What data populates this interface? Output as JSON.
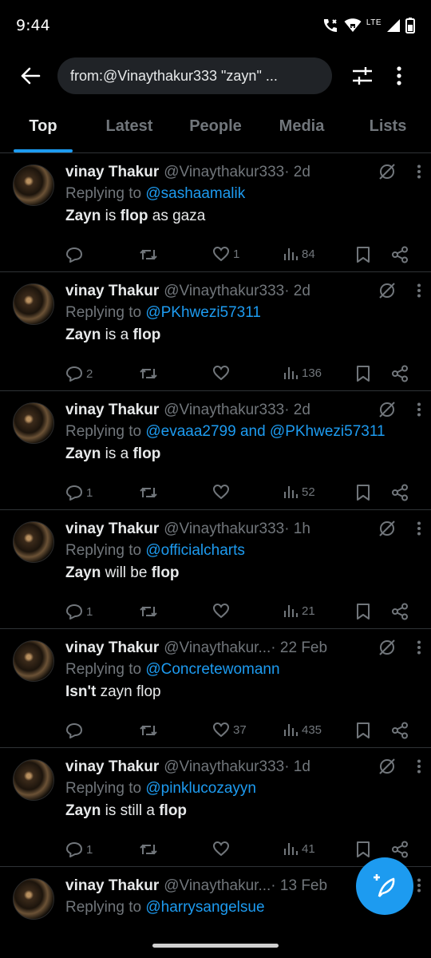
{
  "status_bar": {
    "time": "9:44",
    "network": "LTE"
  },
  "search": {
    "query": "from:@Vinaythakur333 \"zayn\" ..."
  },
  "tabs": [
    {
      "label": "Top",
      "active": true
    },
    {
      "label": "Latest",
      "active": false
    },
    {
      "label": "People",
      "active": false
    },
    {
      "label": "Media",
      "active": false
    },
    {
      "label": "Lists",
      "active": false
    }
  ],
  "tweets": [
    {
      "name": "vinay Thakur",
      "handle": "@Vinaythakur333",
      "date": " · 2d",
      "replying_prefix": "Replying to ",
      "replying_to": "@sashaamalik",
      "text_parts": [
        "Zayn",
        " is ",
        "flop",
        " as gaza",
        ""
      ],
      "replies": "",
      "likes": "1",
      "views": "84"
    },
    {
      "name": "vinay Thakur",
      "handle": "@Vinaythakur333",
      "date": " · 2d",
      "replying_prefix": "Replying to ",
      "replying_to": "@PKhwezi57311",
      "text_parts": [
        "Zayn",
        " is a ",
        "flop",
        "",
        ""
      ],
      "replies": "2",
      "likes": "",
      "views": "136"
    },
    {
      "name": "vinay Thakur",
      "handle": "@Vinaythakur333",
      "date": " · 2d",
      "replying_prefix": "Replying to ",
      "replying_to": "@evaaa2799 and @PKhwezi57311",
      "text_parts": [
        "Zayn",
        " is a ",
        "flop",
        "",
        ""
      ],
      "replies": "1",
      "likes": "",
      "views": "52"
    },
    {
      "name": "vinay Thakur",
      "handle": "@Vinaythakur333",
      "date": " · 1h",
      "replying_prefix": "Replying to ",
      "replying_to": "@officialcharts",
      "text_parts": [
        "Zayn",
        " will be ",
        "flop",
        "",
        ""
      ],
      "replies": "1",
      "likes": "",
      "views": "21"
    },
    {
      "name": "vinay Thakur",
      "handle": "@Vinaythakur...",
      "date": " · 22 Feb",
      "replying_prefix": "Replying to ",
      "replying_to": "@Concretewomann",
      "text_parts": [
        "Isn't ",
        "zayn flop",
        "",
        "",
        ""
      ],
      "replies": "",
      "likes": "37",
      "views": "435"
    },
    {
      "name": "vinay Thakur",
      "handle": "@Vinaythakur333",
      "date": " · 1d",
      "replying_prefix": "Replying to ",
      "replying_to": "@pinklucozayyn",
      "text_parts": [
        "Zayn",
        " is still a ",
        "flop",
        "",
        ""
      ],
      "replies": "1",
      "likes": "",
      "views": "41"
    },
    {
      "name": "vinay Thakur",
      "handle": "@Vinaythakur...",
      "date": " · 13 Feb",
      "replying_prefix": "Replying to ",
      "replying_to": "@harrysangelsue",
      "text_parts": [
        "",
        "",
        "",
        "",
        ""
      ],
      "replies": "",
      "likes": "",
      "views": ""
    }
  ],
  "colors": {
    "accent": "#1d9bf0",
    "background": "#000000",
    "secondary_text": "#71767b",
    "divider": "#2f3336"
  }
}
